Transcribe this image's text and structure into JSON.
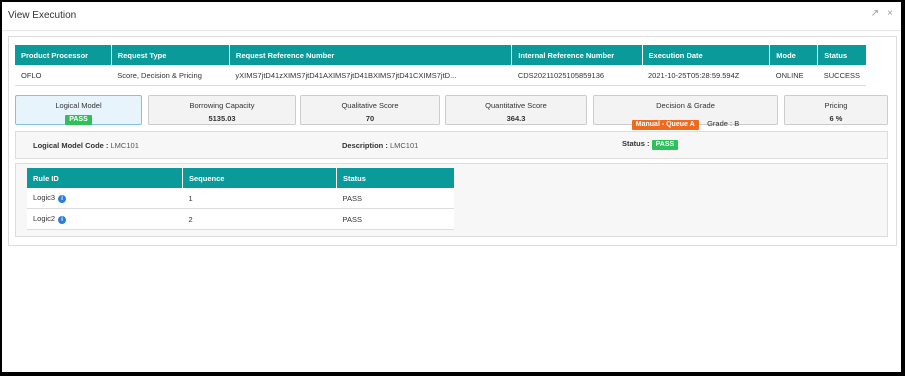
{
  "window": {
    "title": "View Execution",
    "expand_icon": "↗",
    "close_icon": "×"
  },
  "execution_table": {
    "headers": [
      "Product Processor",
      "Request Type",
      "Request Reference Number",
      "Internal Reference Number",
      "Execution Date",
      "Mode",
      "Status"
    ],
    "row": [
      "OFLO",
      "Score, Decision & Pricing",
      "yXIMS7jtD41zXIMS7jtD41AXIMS7jtD41BXIMS7jtD41CXIMS7jtD...",
      "CDS20211025105859136",
      "2021-10-25T05:28:59.594Z",
      "ONLINE",
      "SUCCESS"
    ]
  },
  "tiles": {
    "logical_model": {
      "label": "Logical Model",
      "badge": "PASS"
    },
    "borrowing_capacity": {
      "label": "Borrowing Capacity",
      "value": "5135.03"
    },
    "qualitative_score": {
      "label": "Qualitative Score",
      "value": "70"
    },
    "quantitative_score": {
      "label": "Quantitative Score",
      "value": "364.3"
    },
    "decision_grade": {
      "label": "Decision & Grade",
      "badge": "Manual - Queue A",
      "grade": "Grade : B"
    },
    "pricing": {
      "label": "Pricing",
      "value": "6 %"
    }
  },
  "details": {
    "code_label": "Logical Model Code :",
    "code_value": "LMC101",
    "desc_label": "Description :",
    "desc_value": "LMC101",
    "status_label": "Status :",
    "status_badge": "PASS"
  },
  "rules_table": {
    "headers": [
      "Rule ID",
      "Sequence",
      "Status"
    ],
    "rows": [
      {
        "rule_id": "Logic3",
        "sequence": "1",
        "status": "PASS"
      },
      {
        "rule_id": "Logic2",
        "sequence": "2",
        "status": "PASS"
      }
    ]
  },
  "colors": {
    "header_teal": "#0a9a9a",
    "pass_green": "#2ec05a",
    "queue_orange": "#f06a1e",
    "info_blue": "#2a7fd4"
  }
}
